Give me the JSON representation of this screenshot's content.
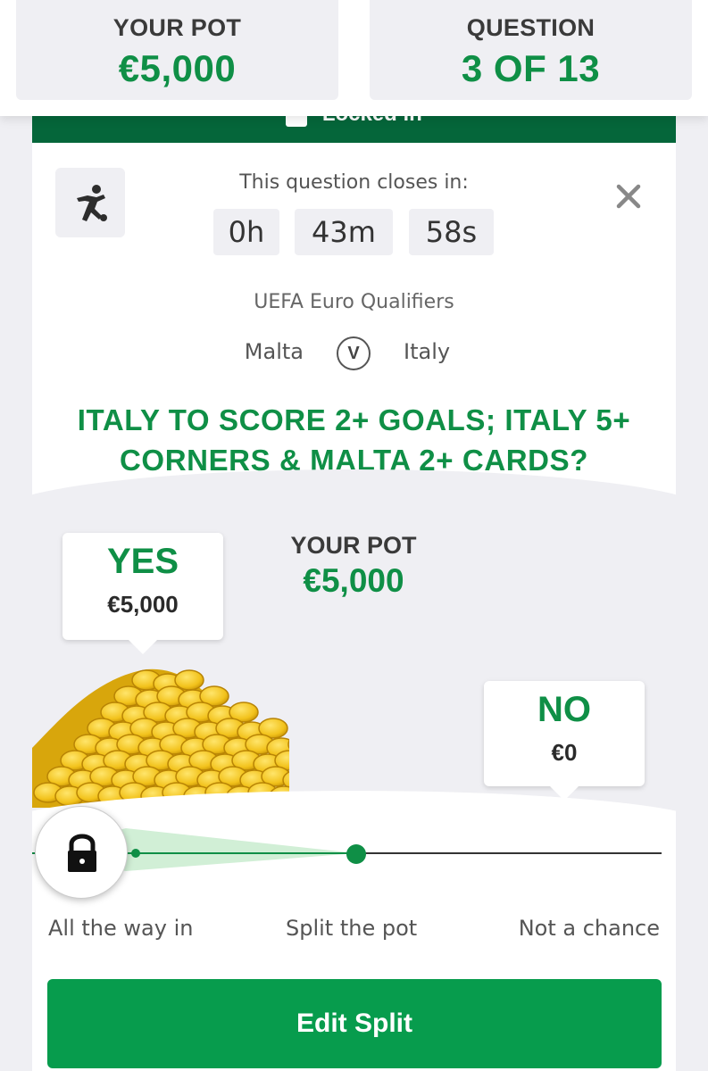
{
  "header": {
    "pot_label": "YOUR POT",
    "pot_value": "€5,000",
    "question_label": "QUESTION",
    "question_value": "3 OF 13"
  },
  "banner": {
    "text": "Locked in"
  },
  "timer": {
    "label": "This question closes in:",
    "hours": "0h",
    "minutes": "43m",
    "seconds": "58s"
  },
  "match": {
    "competition": "UEFA Euro Qualifiers",
    "home": "Malta",
    "vs": "V",
    "away": "Italy"
  },
  "question": {
    "line1": "Italy to score 2+ Goals; Italy 5+",
    "line2": "corners & Malta 2+ cards?"
  },
  "pot": {
    "label": "YOUR POT",
    "value": "€5,000"
  },
  "yes_bubble": {
    "title": "YES",
    "amount": "€5,000"
  },
  "no_bubble": {
    "title": "NO",
    "amount": "€0"
  },
  "slider": {
    "label_left": "All the way in",
    "label_mid": "Split the pot",
    "label_right": "Not a chance",
    "yes_share": 1.0
  },
  "edit_button": {
    "label": "Edit Split"
  },
  "colors": {
    "brand_green": "#0f8f46",
    "dark_green": "#05663a",
    "button_green": "#079c4d",
    "coin_gold": "#f2c21b"
  },
  "icons": {
    "sport": "football-player-icon",
    "close": "close-icon",
    "lock": "lock-icon"
  }
}
